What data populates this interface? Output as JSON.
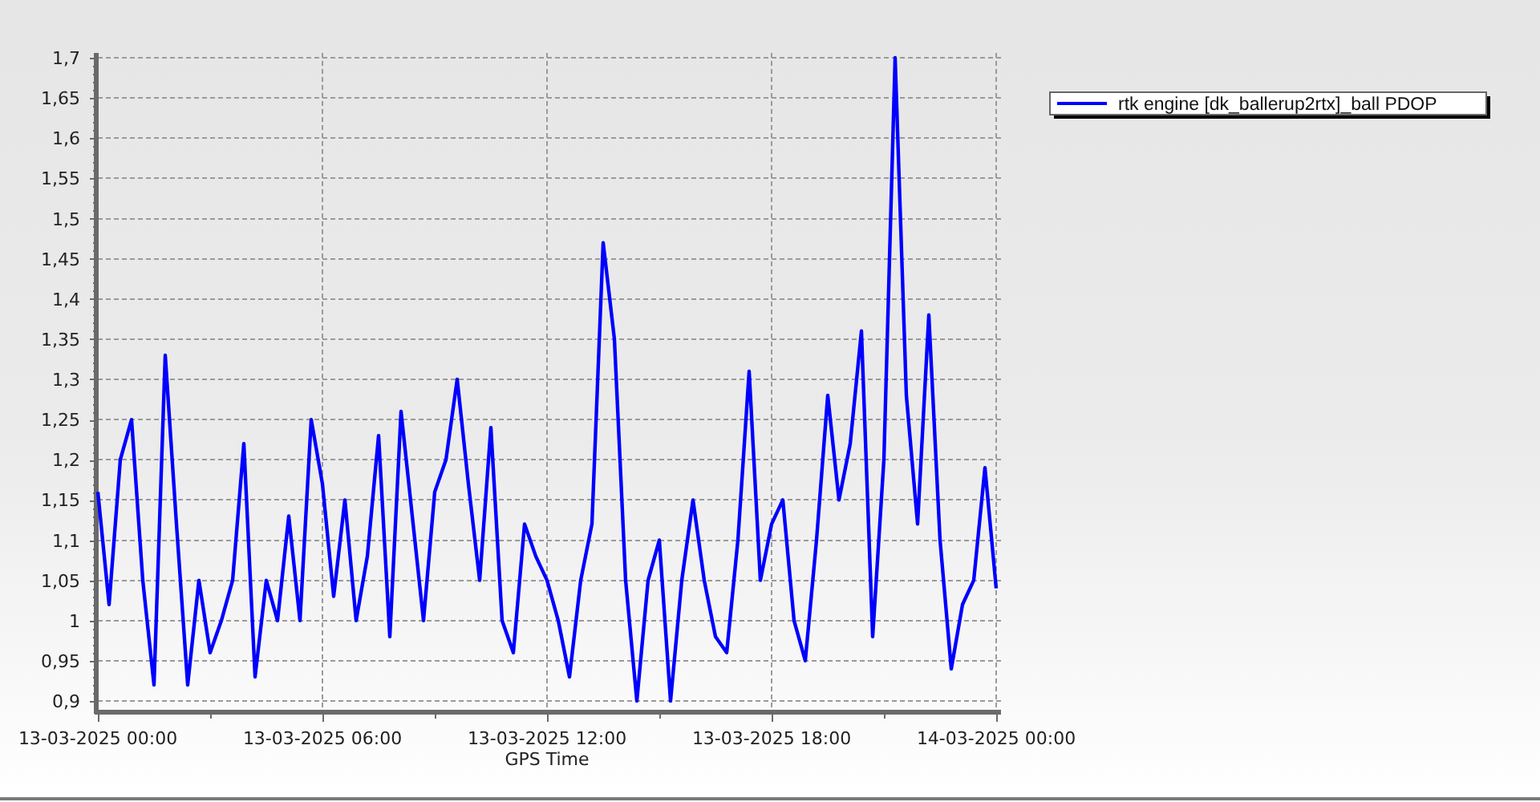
{
  "chart_data": {
    "type": "line",
    "xlabel": "GPS Time",
    "grid": true,
    "categories": [
      "13-03-2025 00:00",
      null,
      null,
      null,
      null,
      null,
      null,
      null,
      null,
      null,
      null,
      null,
      null,
      null,
      null,
      null,
      null,
      null,
      null,
      null,
      "13-03-2025 06:00",
      null,
      null,
      null,
      null,
      null,
      null,
      null,
      null,
      null,
      null,
      null,
      null,
      null,
      null,
      null,
      null,
      null,
      null,
      null,
      "13-03-2025 12:00",
      null,
      null,
      null,
      null,
      null,
      null,
      null,
      null,
      null,
      null,
      null,
      null,
      null,
      null,
      null,
      null,
      null,
      null,
      null,
      "13-03-2025 18:00",
      null,
      null,
      null,
      null,
      null,
      null,
      null,
      null,
      null,
      null,
      null,
      null,
      null,
      null,
      null,
      null,
      null,
      null,
      null,
      "14-03-2025 00:00"
    ],
    "series": [
      {
        "name": "rtk engine [dk_ballerup2rtx]_ball PDOP",
        "color": "#0000ff",
        "values": [
          1.16,
          1.02,
          1.2,
          1.25,
          1.05,
          0.92,
          1.33,
          1.12,
          0.92,
          1.05,
          0.96,
          1.0,
          1.05,
          1.22,
          0.93,
          1.05,
          1.0,
          1.13,
          1.0,
          1.25,
          1.17,
          1.03,
          1.15,
          1.0,
          1.08,
          1.23,
          0.98,
          1.26,
          1.13,
          1.0,
          1.16,
          1.2,
          1.3,
          1.17,
          1.05,
          1.24,
          1.0,
          0.96,
          1.12,
          1.08,
          1.05,
          1.0,
          0.93,
          1.05,
          1.12,
          1.47,
          1.35,
          1.05,
          0.9,
          1.05,
          1.1,
          0.9,
          1.05,
          1.15,
          1.05,
          0.98,
          0.96,
          1.1,
          1.31,
          1.05,
          1.12,
          1.15,
          1.0,
          0.95,
          1.1,
          1.28,
          1.15,
          1.22,
          1.36,
          0.98,
          1.2,
          1.7,
          1.28,
          1.12,
          1.38,
          1.1,
          0.94,
          1.02,
          1.05,
          1.19,
          1.04
        ]
      }
    ],
    "ylim": [
      0.9,
      1.7
    ],
    "yticks": [
      {
        "value": 0.9,
        "label": "0,9"
      },
      {
        "value": 0.95,
        "label": "0,95"
      },
      {
        "value": 1,
        "label": "1"
      },
      {
        "value": 1.05,
        "label": "1,05"
      },
      {
        "value": 1.1,
        "label": "1,1"
      },
      {
        "value": 1.15,
        "label": "1,15"
      },
      {
        "value": 1.2,
        "label": "1,2"
      },
      {
        "value": 1.25,
        "label": "1,25"
      },
      {
        "value": 1.3,
        "label": "1,3"
      },
      {
        "value": 1.35,
        "label": "1,35"
      },
      {
        "value": 1.4,
        "label": "1,4"
      },
      {
        "value": 1.45,
        "label": "1,45"
      },
      {
        "value": 1.5,
        "label": "1,5"
      },
      {
        "value": 1.55,
        "label": "1,55"
      },
      {
        "value": 1.6,
        "label": "1,6"
      },
      {
        "value": 1.65,
        "label": "1,65"
      },
      {
        "value": 1.7,
        "label": "1,7"
      }
    ]
  }
}
